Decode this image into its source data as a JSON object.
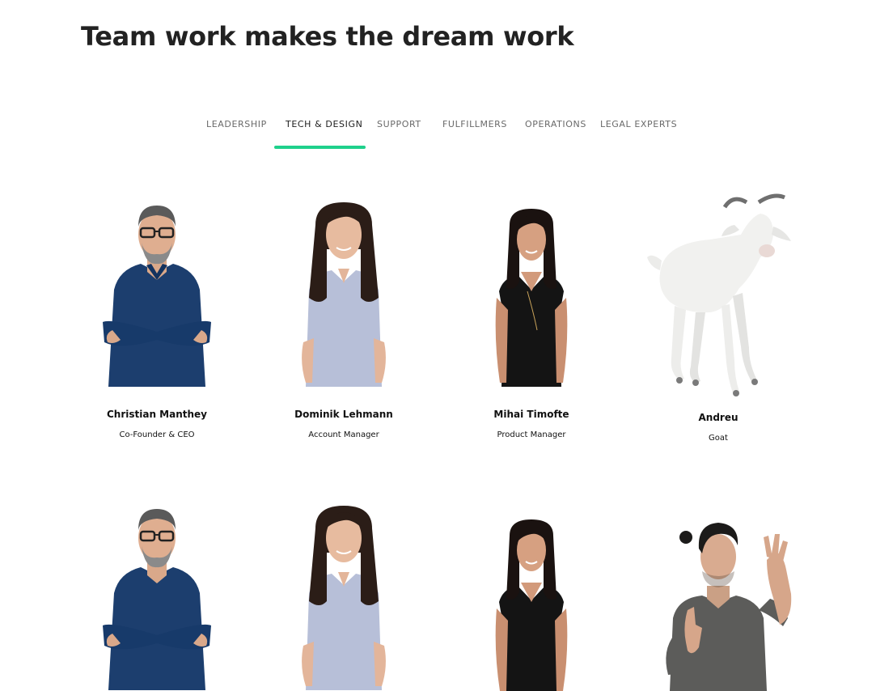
{
  "page": {
    "title": "Team work makes the dream work"
  },
  "tabs": [
    {
      "label": "LEADERSHIP",
      "active": false
    },
    {
      "label": "TECH & DESIGN",
      "active": true
    },
    {
      "label": "SUPPORT",
      "active": false
    },
    {
      "label": "FULFILLMERS",
      "active": false
    },
    {
      "label": "OPERATIONS",
      "active": false
    },
    {
      "label": "LEGAL EXPERTS",
      "active": false
    }
  ],
  "accent_color": "#1fd18c",
  "team_row1": [
    {
      "name": "Christian Manthey",
      "role": "Co-Founder & CEO",
      "photo": "man-glasses-photo"
    },
    {
      "name": "Dominik Lehmann",
      "role": "Account Manager",
      "photo": "woman-shirt-photo"
    },
    {
      "name": "Mihai Timofte",
      "role": "Product Manager",
      "photo": "woman-black-top-photo"
    },
    {
      "name": "Andreu",
      "role": "Goat",
      "photo": "goat-photo"
    }
  ],
  "team_row2": [
    {
      "photo": "man-glasses-photo"
    },
    {
      "photo": "woman-shirt-photo"
    },
    {
      "photo": "woman-black-top-photo"
    },
    {
      "photo": "man-waving-photo"
    }
  ]
}
